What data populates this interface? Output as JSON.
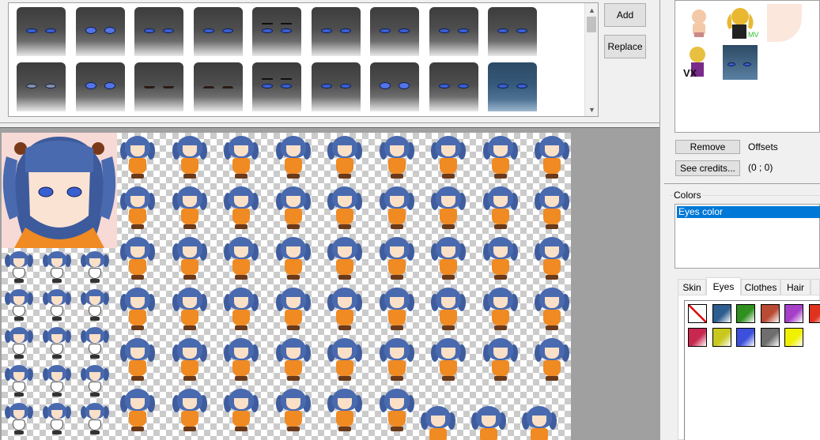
{
  "toolbar": {
    "add_label": "Add",
    "replace_label": "Replace"
  },
  "parts": {
    "remove_label": "Remove",
    "see_credits_label": "See credits...",
    "offsets_label": "Offsets",
    "offsets_value": "(0 ; 0)",
    "thumb_badges": [
      "MV",
      "VX"
    ]
  },
  "colors": {
    "legend": "Colors",
    "items": [
      "Eyes color"
    ]
  },
  "tabs": [
    {
      "label": "Skin"
    },
    {
      "label": "Eyes"
    },
    {
      "label": "Clothes"
    },
    {
      "label": "Hair"
    }
  ],
  "swatches": [
    {
      "color": "#ffffff",
      "kind": "none"
    },
    {
      "color": "#2e5d8f"
    },
    {
      "color": "#2f8f1f"
    },
    {
      "color": "#b94a34"
    },
    {
      "color": "#a640c8"
    },
    {
      "color": "#e0321e"
    },
    {
      "color": "#c82850"
    },
    {
      "color": "#c8c81e"
    },
    {
      "color": "#3c50dc"
    },
    {
      "color": "#6e6e6e"
    },
    {
      "color": "#f0f000"
    }
  ],
  "scrollbar": {
    "up_glyph": "▲",
    "down_glyph": "▼"
  }
}
